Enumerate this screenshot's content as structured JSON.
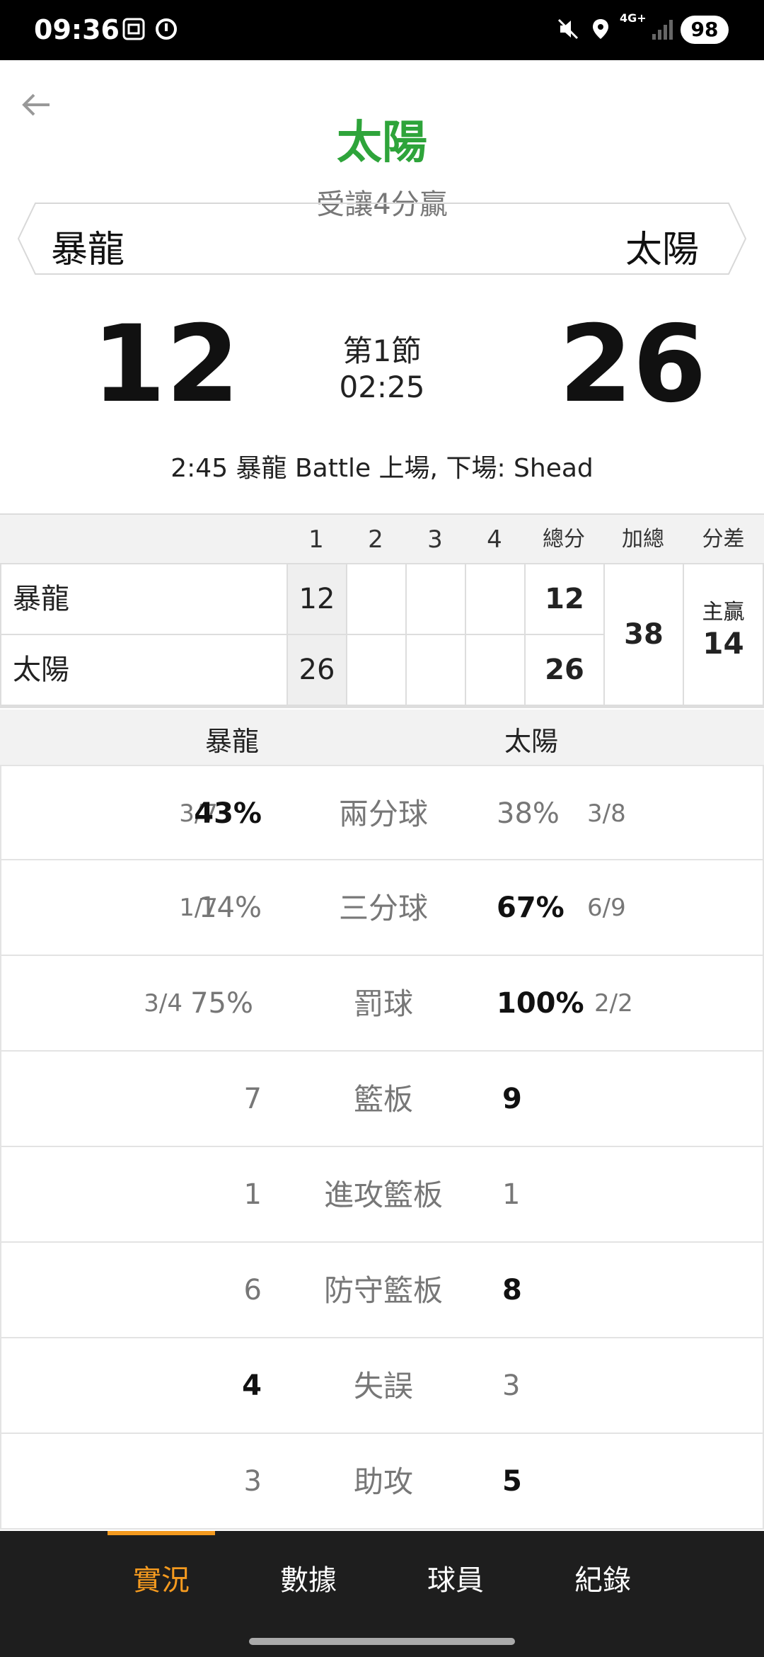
{
  "status_bar": {
    "time": "09:36",
    "battery": "98",
    "network": "4G+",
    "icons": [
      "screenshot-icon",
      "data-saver-icon",
      "mute-icon",
      "location-icon",
      "network-4g-icon",
      "signal-icon",
      "battery-icon"
    ]
  },
  "header": {
    "back_icon": "arrow-left-icon",
    "winner": "太陽",
    "handicap_text": "受讓4分贏",
    "team_left": "暴龍",
    "team_right": "太陽"
  },
  "score": {
    "left": "12",
    "right": "26",
    "period": "第1節",
    "clock": "02:25",
    "last_play": "2:45 暴龍 Battle 上場, 下場: Shead"
  },
  "quarter_table": {
    "headers": [
      "1",
      "2",
      "3",
      "4",
      "總分",
      "加總",
      "分差"
    ],
    "rows": [
      {
        "team": "暴龍",
        "q1": "12",
        "q2": "",
        "q3": "",
        "q4": "",
        "total": "12"
      },
      {
        "team": "太陽",
        "q1": "26",
        "q2": "",
        "q3": "",
        "q4": "",
        "total": "26"
      }
    ],
    "sum": "38",
    "diff_label": "主贏",
    "diff_value": "14"
  },
  "stats": {
    "team_left": "暴龍",
    "team_right": "太陽",
    "two_pt": {
      "label": "兩分球",
      "left_frac": "3/7",
      "left_pct": "43%",
      "right_pct": "38%",
      "right_frac": "3/8"
    },
    "three_pt": {
      "label": "三分球",
      "left_frac": "1/7",
      "left_pct": "14%",
      "right_pct": "67%",
      "right_frac": "6/9"
    },
    "free_throw": {
      "label": "罰球",
      "left_frac": "3/4",
      "left_pct": "75%",
      "right_pct": "100%",
      "right_frac": "2/2"
    },
    "rebounds": {
      "label": "籃板",
      "left": "7",
      "right": "9"
    },
    "off_rebounds": {
      "label": "進攻籃板",
      "left": "1",
      "right": "1"
    },
    "def_rebounds": {
      "label": "防守籃板",
      "left": "6",
      "right": "8"
    },
    "turnovers": {
      "label": "失誤",
      "left": "4",
      "right": "3"
    },
    "assists": {
      "label": "助攻",
      "left": "3",
      "right": "5"
    }
  },
  "bottom_nav": {
    "tabs": [
      {
        "label": "實況",
        "active": true
      },
      {
        "label": "數據",
        "active": false
      },
      {
        "label": "球員",
        "active": false
      },
      {
        "label": "紀錄",
        "active": false
      }
    ],
    "active_color": "#f49a1f"
  },
  "colors": {
    "winner": "#2ea43a",
    "accent": "#f49a1f"
  }
}
